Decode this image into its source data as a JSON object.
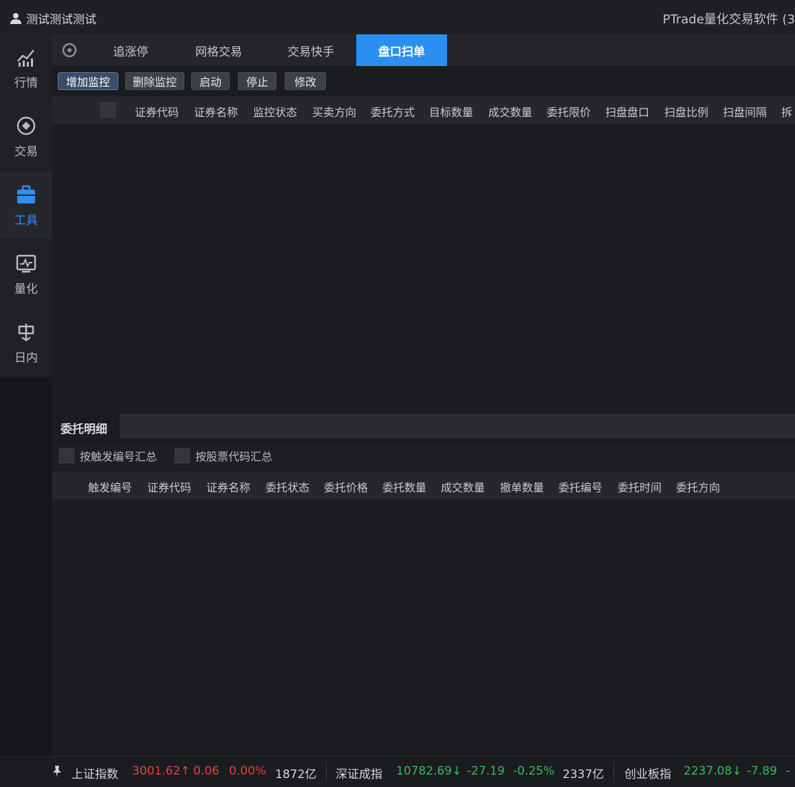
{
  "window": {
    "user_name": "测试测试测试",
    "app_title": "PTrade量化交易软件 (3"
  },
  "nav": {
    "items": [
      {
        "label": "行情",
        "icon": "market-chart-icon"
      },
      {
        "label": "交易",
        "icon": "trade-icon"
      },
      {
        "label": "工具",
        "icon": "toolbox-icon",
        "active": true
      },
      {
        "label": "量化",
        "icon": "quant-icon"
      },
      {
        "label": "日内",
        "icon": "intraday-icon"
      }
    ]
  },
  "tabs": [
    {
      "label": "追涨停"
    },
    {
      "label": "网格交易"
    },
    {
      "label": "交易快手"
    },
    {
      "label": "盘口扫单",
      "active": true
    }
  ],
  "toolbar": {
    "add_monitor": "增加监控",
    "delete_monitor": "删除监控",
    "start": "启动",
    "stop": "停止",
    "modify": "修改"
  },
  "monitor_table": {
    "columns": [
      "证券代码",
      "证券名称",
      "监控状态",
      "买卖方向",
      "委托方式",
      "目标数量",
      "成交数量",
      "委托限价",
      "扫盘盘口",
      "扫盘比例",
      "扫盘间隔",
      "拆"
    ],
    "rows": []
  },
  "entrust": {
    "title": "委托明细",
    "filters": [
      "按触发编号汇总",
      "按股票代码汇总"
    ],
    "columns": [
      "触发编号",
      "证券代码",
      "证券名称",
      "委托状态",
      "委托价格",
      "委托数量",
      "成交数量",
      "撤单数量",
      "委托编号",
      "委托时间",
      "委托方向"
    ],
    "rows": []
  },
  "status_bar": {
    "indices": [
      {
        "name": "上证指数",
        "price": "3001.62",
        "arrow": "↑",
        "change": "0.06",
        "pct": "0.00%",
        "volume": "1872亿",
        "trend": "up"
      },
      {
        "name": "深证成指",
        "price": "10782.69",
        "arrow": "↓",
        "change": "-27.19",
        "pct": "-0.25%",
        "volume": "2337亿",
        "trend": "down"
      },
      {
        "name": "创业板指",
        "price": "2237.08",
        "arrow": "↓",
        "change": "-7.89",
        "pct": "-",
        "trend": "down"
      }
    ],
    "colors": {
      "up": "#e0403f",
      "down": "#2fbf55",
      "accent": "#2a8ff0"
    }
  }
}
